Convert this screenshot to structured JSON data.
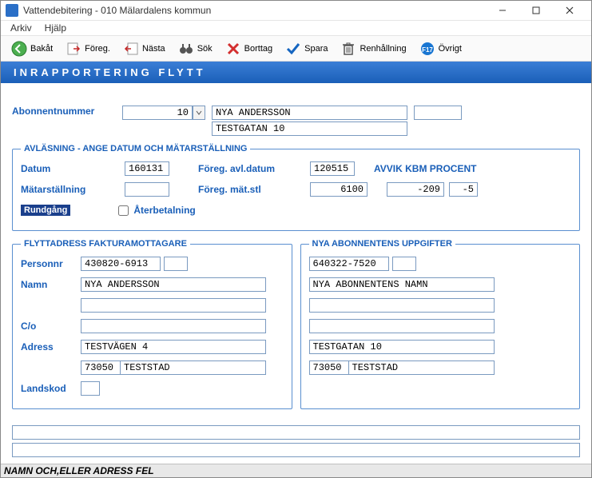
{
  "titlebar": {
    "title": "Vattendebitering  -  010 Mälardalens kommun"
  },
  "menu": {
    "arkiv": "Arkiv",
    "hjalp": "Hjälp"
  },
  "toolbar": {
    "bakat": "Bakåt",
    "foreg": "Föreg.",
    "nasta": "Nästa",
    "sok": "Sök",
    "borttag": "Borttag",
    "spara": "Spara",
    "renhallning": "Renhållning",
    "ovrigt": "Övrigt"
  },
  "banner": {
    "title": "INRAPPORTERING FLYTT"
  },
  "abonnent": {
    "label": "Abonnentnummer",
    "value": "10",
    "name": "NYA ANDERSSON",
    "addr": "TESTGATAN 10"
  },
  "avlasning": {
    "legend": "AVLÄSNING - ANGE DATUM OCH MÄTARSTÄLLNING",
    "datum_label": "Datum",
    "datum": "160131",
    "foreg_datum_label": "Föreg. avl.datum",
    "foreg_datum": "120515",
    "avvik_label": "AVVIK KBM PROCENT",
    "matar_label": "Mätarställning",
    "matar": "",
    "foreg_matar_label": "Föreg. mät.stl",
    "foreg_matar": "6100",
    "avvik_kbm": "-209",
    "avvik_pct": "-5",
    "rundgang": "Rundgång",
    "aterbetalning": "Återbetalning"
  },
  "faktura": {
    "legend": "FLYTTADRESS FAKTURAMOTTAGARE",
    "personnr_label": "Personnr",
    "personnr": "430820-6913",
    "namn_label": "Namn",
    "namn": "NYA ANDERSSON",
    "co_label": "C/o",
    "co": "",
    "adress_label": "Adress",
    "adress": "TESTVÄGEN 4",
    "postnr": "73050",
    "ort": "TESTSTAD",
    "landskod_label": "Landskod",
    "landskod": ""
  },
  "nya": {
    "legend": "NYA ABONNENTENS UPPGIFTER",
    "personnr": "640322-7520",
    "namn": "NYA ABONNENTENS NAMN",
    "co": "",
    "adress": "TESTGATAN 10",
    "postnr": "73050",
    "ort": "TESTSTAD"
  },
  "status": {
    "text": "NAMN OCH,ELLER ADRESS FEL"
  }
}
